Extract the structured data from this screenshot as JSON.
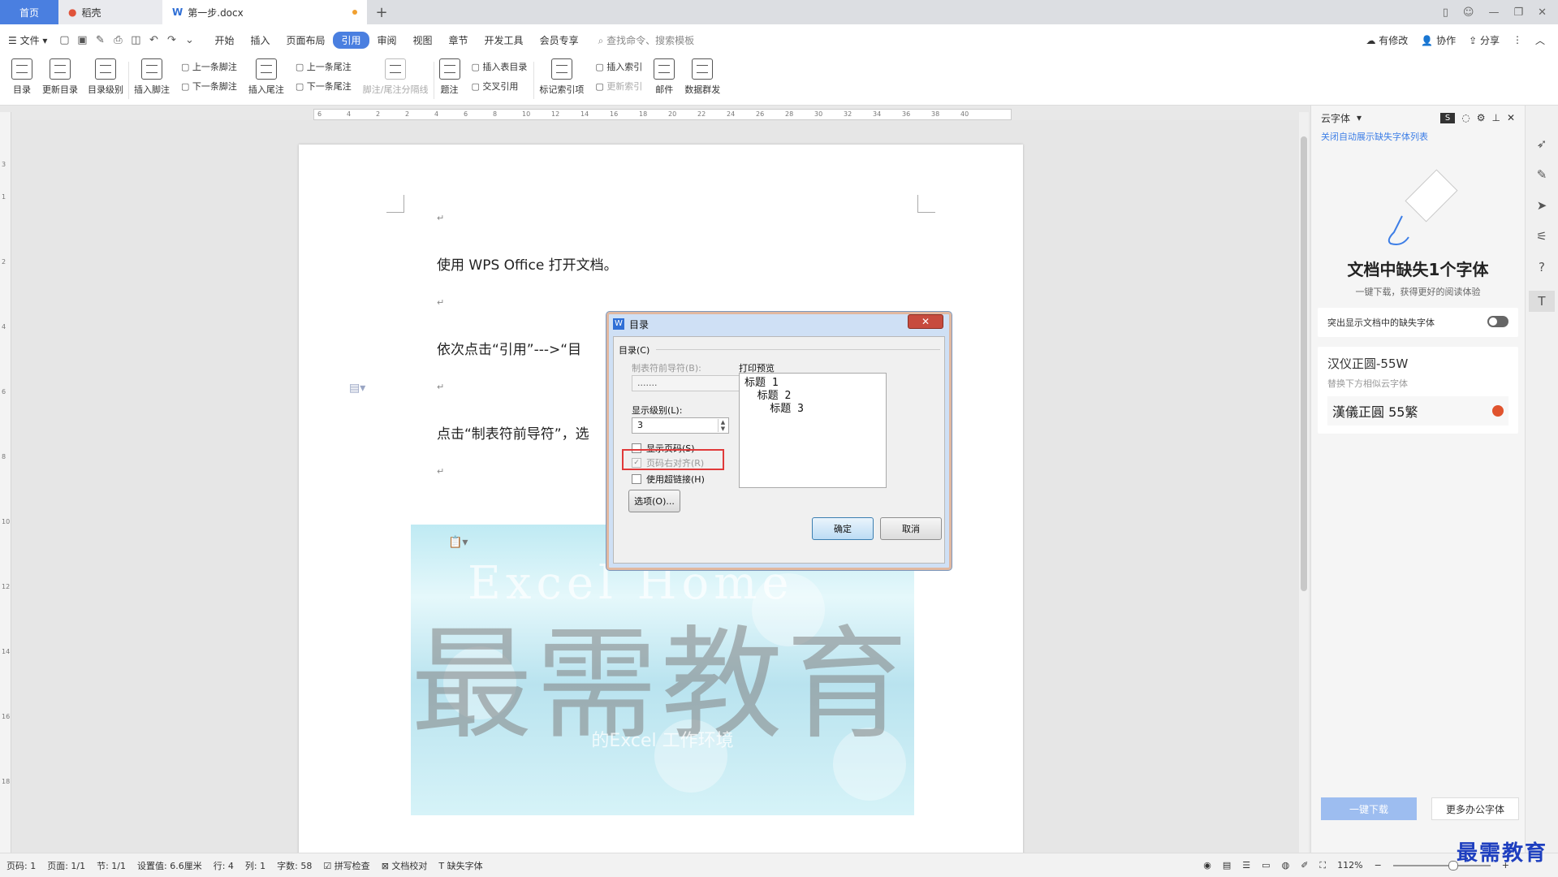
{
  "tabs": {
    "home": "首页",
    "daoke": "稻壳",
    "doc": "第一步.docx",
    "add": "+"
  },
  "menu": {
    "file": "文件",
    "items": [
      "开始",
      "插入",
      "页面布局",
      "引用",
      "审阅",
      "视图",
      "章节",
      "开发工具",
      "会员专享"
    ],
    "active_index": 3,
    "search": "查找命令、搜索模板",
    "right": [
      "有修改",
      "协作",
      "分享"
    ]
  },
  "ribbon": {
    "toc": "目录",
    "update_toc": "更新目录",
    "toc_level": "目录级别",
    "insert_footnote": "插入脚注",
    "prev_footnote": "上一条脚注",
    "next_footnote": "下一条脚注",
    "insert_endnote": "插入尾注",
    "prev_endnote": "上一条尾注",
    "next_endnote": "下一条尾注",
    "note_separator": "脚注/尾注分隔线",
    "caption": "题注",
    "insert_table_toc": "插入表目录",
    "cross_ref": "交叉引用",
    "mark_index": "标记索引项",
    "insert_index": "插入索引",
    "update_index": "更新索引",
    "mail": "邮件",
    "mail_merge": "数据群发"
  },
  "document": {
    "p1": "使用 WPS Office 打开文档。",
    "p2": "依次点击“引用”--->“目",
    "p3": "点击“制表符前导符”，选",
    "para_mark": "↵",
    "image_wm_en": "Excel Home",
    "image_wm_cn": "最需教育",
    "image_wm_sub": "的Excel 工作环境"
  },
  "dialog": {
    "title": "目录",
    "close": "✕",
    "group": "目录(C)",
    "leader_label": "制表符前导符(B):",
    "leader_value": ".......",
    "level_label": "显示级别(L):",
    "level_value": "3",
    "show_page": "显示页码(S)",
    "right_align": "页码右对齐(R)",
    "hyperlink": "使用超链接(H)",
    "options": "选项(O)...",
    "preview_label": "打印预览",
    "preview_lines": [
      "标题 1",
      "  标题 2",
      "    标题 3"
    ],
    "ok": "确定",
    "cancel": "取消"
  },
  "right_panel": {
    "header": "云字体",
    "link": "关闭自动展示缺失字体列表",
    "title": "文档中缺失1个字体",
    "subtitle": "一键下载，获得更好的阅读体验",
    "highlight_toggle": "突出显示文档中的缺失字体",
    "font_name": "汉仪正圆-55W",
    "font_hint": "替换下方相似云字体",
    "font_alt": "漢儀正圓 55繁",
    "download_all": "一键下载",
    "more_fonts": "更多办公字体"
  },
  "status": {
    "page": "页码: 1",
    "pages": "页面: 1/1",
    "section": "节: 1/1",
    "setting": "设置值: 6.6厘米",
    "row": "行: 4",
    "col": "列: 1",
    "words": "字数: 58",
    "spell": "拼写检查",
    "proof": "文档校对",
    "missing_font": "缺失字体",
    "zoom": "112%"
  },
  "watermark": "最需教育",
  "colors": {
    "accent": "#4a7fe0",
    "highlight_box": "#e03a3a"
  }
}
